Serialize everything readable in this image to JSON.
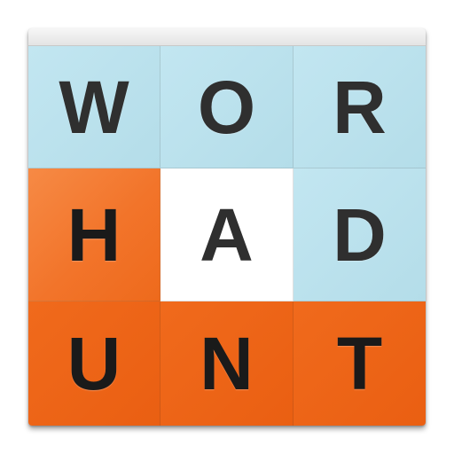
{
  "board": {
    "tiles": [
      {
        "letter": "W",
        "style": "blue"
      },
      {
        "letter": "O",
        "style": "blue"
      },
      {
        "letter": "R",
        "style": "blue"
      },
      {
        "letter": "H",
        "style": "orange"
      },
      {
        "letter": "A",
        "style": "white"
      },
      {
        "letter": "D",
        "style": "blue"
      },
      {
        "letter": "U",
        "style": "orange"
      },
      {
        "letter": "N",
        "style": "orange"
      },
      {
        "letter": "T",
        "style": "orange"
      }
    ]
  },
  "colors": {
    "blue_tile": "#bfe3ee",
    "white_tile": "#ffffff",
    "orange_tile": "#ed6418",
    "letter": "#2c2c2c"
  }
}
